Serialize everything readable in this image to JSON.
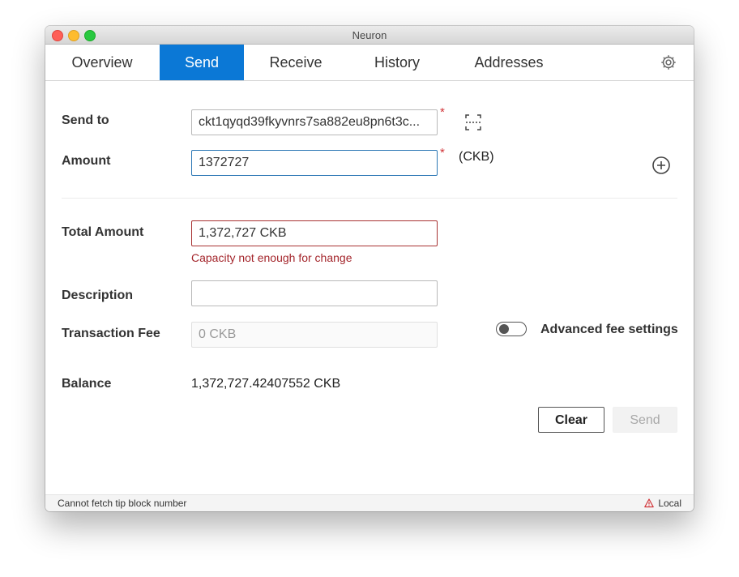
{
  "window": {
    "title": "Neuron"
  },
  "nav": {
    "tabs": [
      {
        "label": "Overview"
      },
      {
        "label": "Send",
        "active": true
      },
      {
        "label": "Receive"
      },
      {
        "label": "History"
      },
      {
        "label": "Addresses"
      }
    ],
    "settings_icon": "gear-icon"
  },
  "form": {
    "send_to": {
      "label": "Send to",
      "value": "ckt1qyqd39fkyvnrs7sa882eu8pn6t3c...",
      "required_mark": "*",
      "scan_icon": "scan-icon"
    },
    "amount": {
      "label": "Amount",
      "value": "1372727",
      "required_mark": "*",
      "unit": "(CKB)",
      "add_icon": "plus-circle-icon"
    },
    "total_amount": {
      "label": "Total Amount",
      "value": "1,372,727 CKB",
      "error": "Capacity not enough for change"
    },
    "description": {
      "label": "Description",
      "value": ""
    },
    "transaction_fee": {
      "label": "Transaction Fee",
      "value": "0 CKB"
    },
    "advanced_fee": {
      "label": "Advanced fee settings",
      "enabled": false
    },
    "balance": {
      "label": "Balance",
      "value": "1,372,727.42407552 CKB"
    }
  },
  "actions": {
    "clear_label": "Clear",
    "send_label": "Send"
  },
  "status": {
    "left": "Cannot fetch tip block number",
    "right": "Local",
    "warning_icon": "warning-icon"
  },
  "colors": {
    "accent": "#0b78d6",
    "error": "#a4262c",
    "required": "#d13438"
  }
}
